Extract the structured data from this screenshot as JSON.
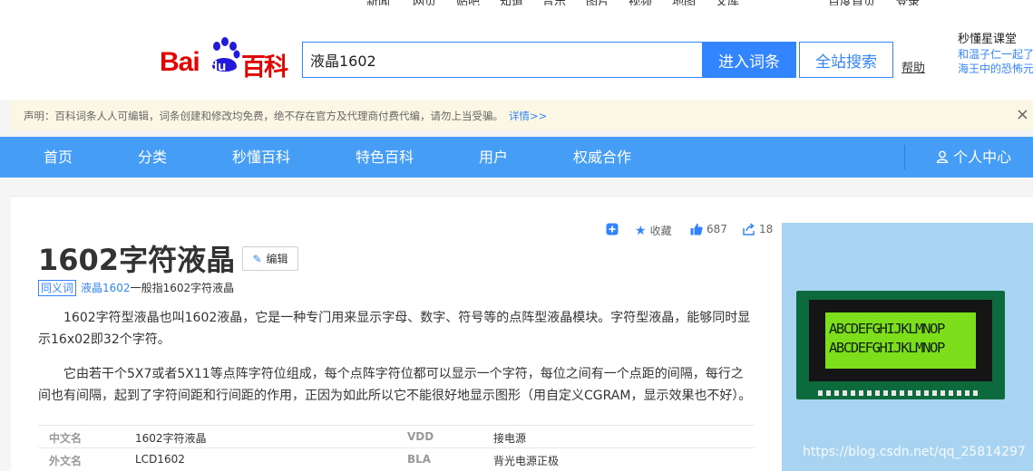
{
  "header": {
    "logo_text_bai": "Bai",
    "logo_text_du": "du",
    "logo_text_baike": "百科",
    "search_value": "液晶1602",
    "enter_button": "进入词条",
    "search_all_button": "全站搜索",
    "help_link": "帮助",
    "promo": {
      "title": "秒懂星课堂",
      "line1": "和温子仁一起了",
      "line2": "海王中的恐怖元"
    }
  },
  "notice": {
    "text": "声明：百科词条人人可编辑，词条创建和修改均免费，绝不存在官方及代理商付费代编，请勿上当受骗。",
    "more_link": "详情>>",
    "close_icon": "×"
  },
  "nav": {
    "items": [
      "首页",
      "分类",
      "秒懂百科",
      "特色百科",
      "用户",
      "权威合作"
    ],
    "user_center": "个人中心"
  },
  "article": {
    "tools": {
      "collect": "收藏",
      "like_count": "687",
      "share_count": "18"
    },
    "title": "1602字符液晶",
    "edit_button": "编辑",
    "synonym": {
      "tag": "同义词",
      "link": "液晶1602",
      "rest": "一般指1602字符液晶"
    },
    "paragraphs": [
      "1602字符型液晶也叫1602液晶，它是一种专门用来显示字母、数字、符号等的点阵型液晶模块。字符型液晶，能够同时显示16x02即32个字符。",
      "它由若干个5X7或者5X11等点阵字符位组成，每个点阵字符位都可以显示一个字符，每位之间有一个点距的间隔，每行之间也有间隔，起到了字符间距和行间距的作用，正因为如此所以它不能很好地显示图形（用自定义CGRAM，显示效果也不好）。"
    ],
    "basic_info": [
      {
        "k1": "中文名",
        "v1": "1602字符液晶",
        "k2": "VDD",
        "v2": "接电源"
      },
      {
        "k1": "外文名",
        "v1": "LCD1602",
        "k2": "BLA",
        "v2": "背光电源正极"
      }
    ]
  },
  "album": {
    "lcd_line1": "ABCDEFGHIJKLMNOP",
    "lcd_line2": "ABCDEFGHIJKLMNOP",
    "watermark": "https://blog.csdn.net/qq_25814297"
  },
  "colors": {
    "brand_red": "#e10601",
    "accent_blue": "#3385ff",
    "nav_blue": "#459df5",
    "lcd_green": "#7dde1c"
  }
}
